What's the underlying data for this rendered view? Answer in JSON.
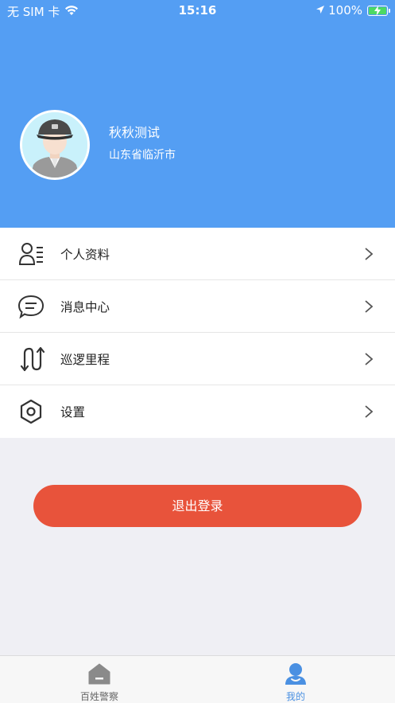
{
  "status_bar": {
    "carrier": "无 SIM 卡",
    "time": "15:16",
    "battery": "100%"
  },
  "profile": {
    "name": "秋秋测试",
    "location": "山东省临沂市"
  },
  "menu": {
    "items": [
      {
        "label": "个人资料",
        "icon": "profile-card-icon"
      },
      {
        "label": "消息中心",
        "icon": "chat-bubble-icon"
      },
      {
        "label": "巡逻里程",
        "icon": "route-arrows-icon"
      },
      {
        "label": "设置",
        "icon": "settings-hexagon-icon"
      }
    ]
  },
  "logout_label": "退出登录",
  "tabbar": {
    "tabs": [
      {
        "label": "百姓警察",
        "icon": "home-icon",
        "active": false
      },
      {
        "label": "我的",
        "icon": "user-icon",
        "active": true
      }
    ]
  },
  "colors": {
    "header": "#549ef3",
    "logout": "#e8533b",
    "tab_active": "#4a90e2",
    "tab_inactive": "#666666"
  }
}
